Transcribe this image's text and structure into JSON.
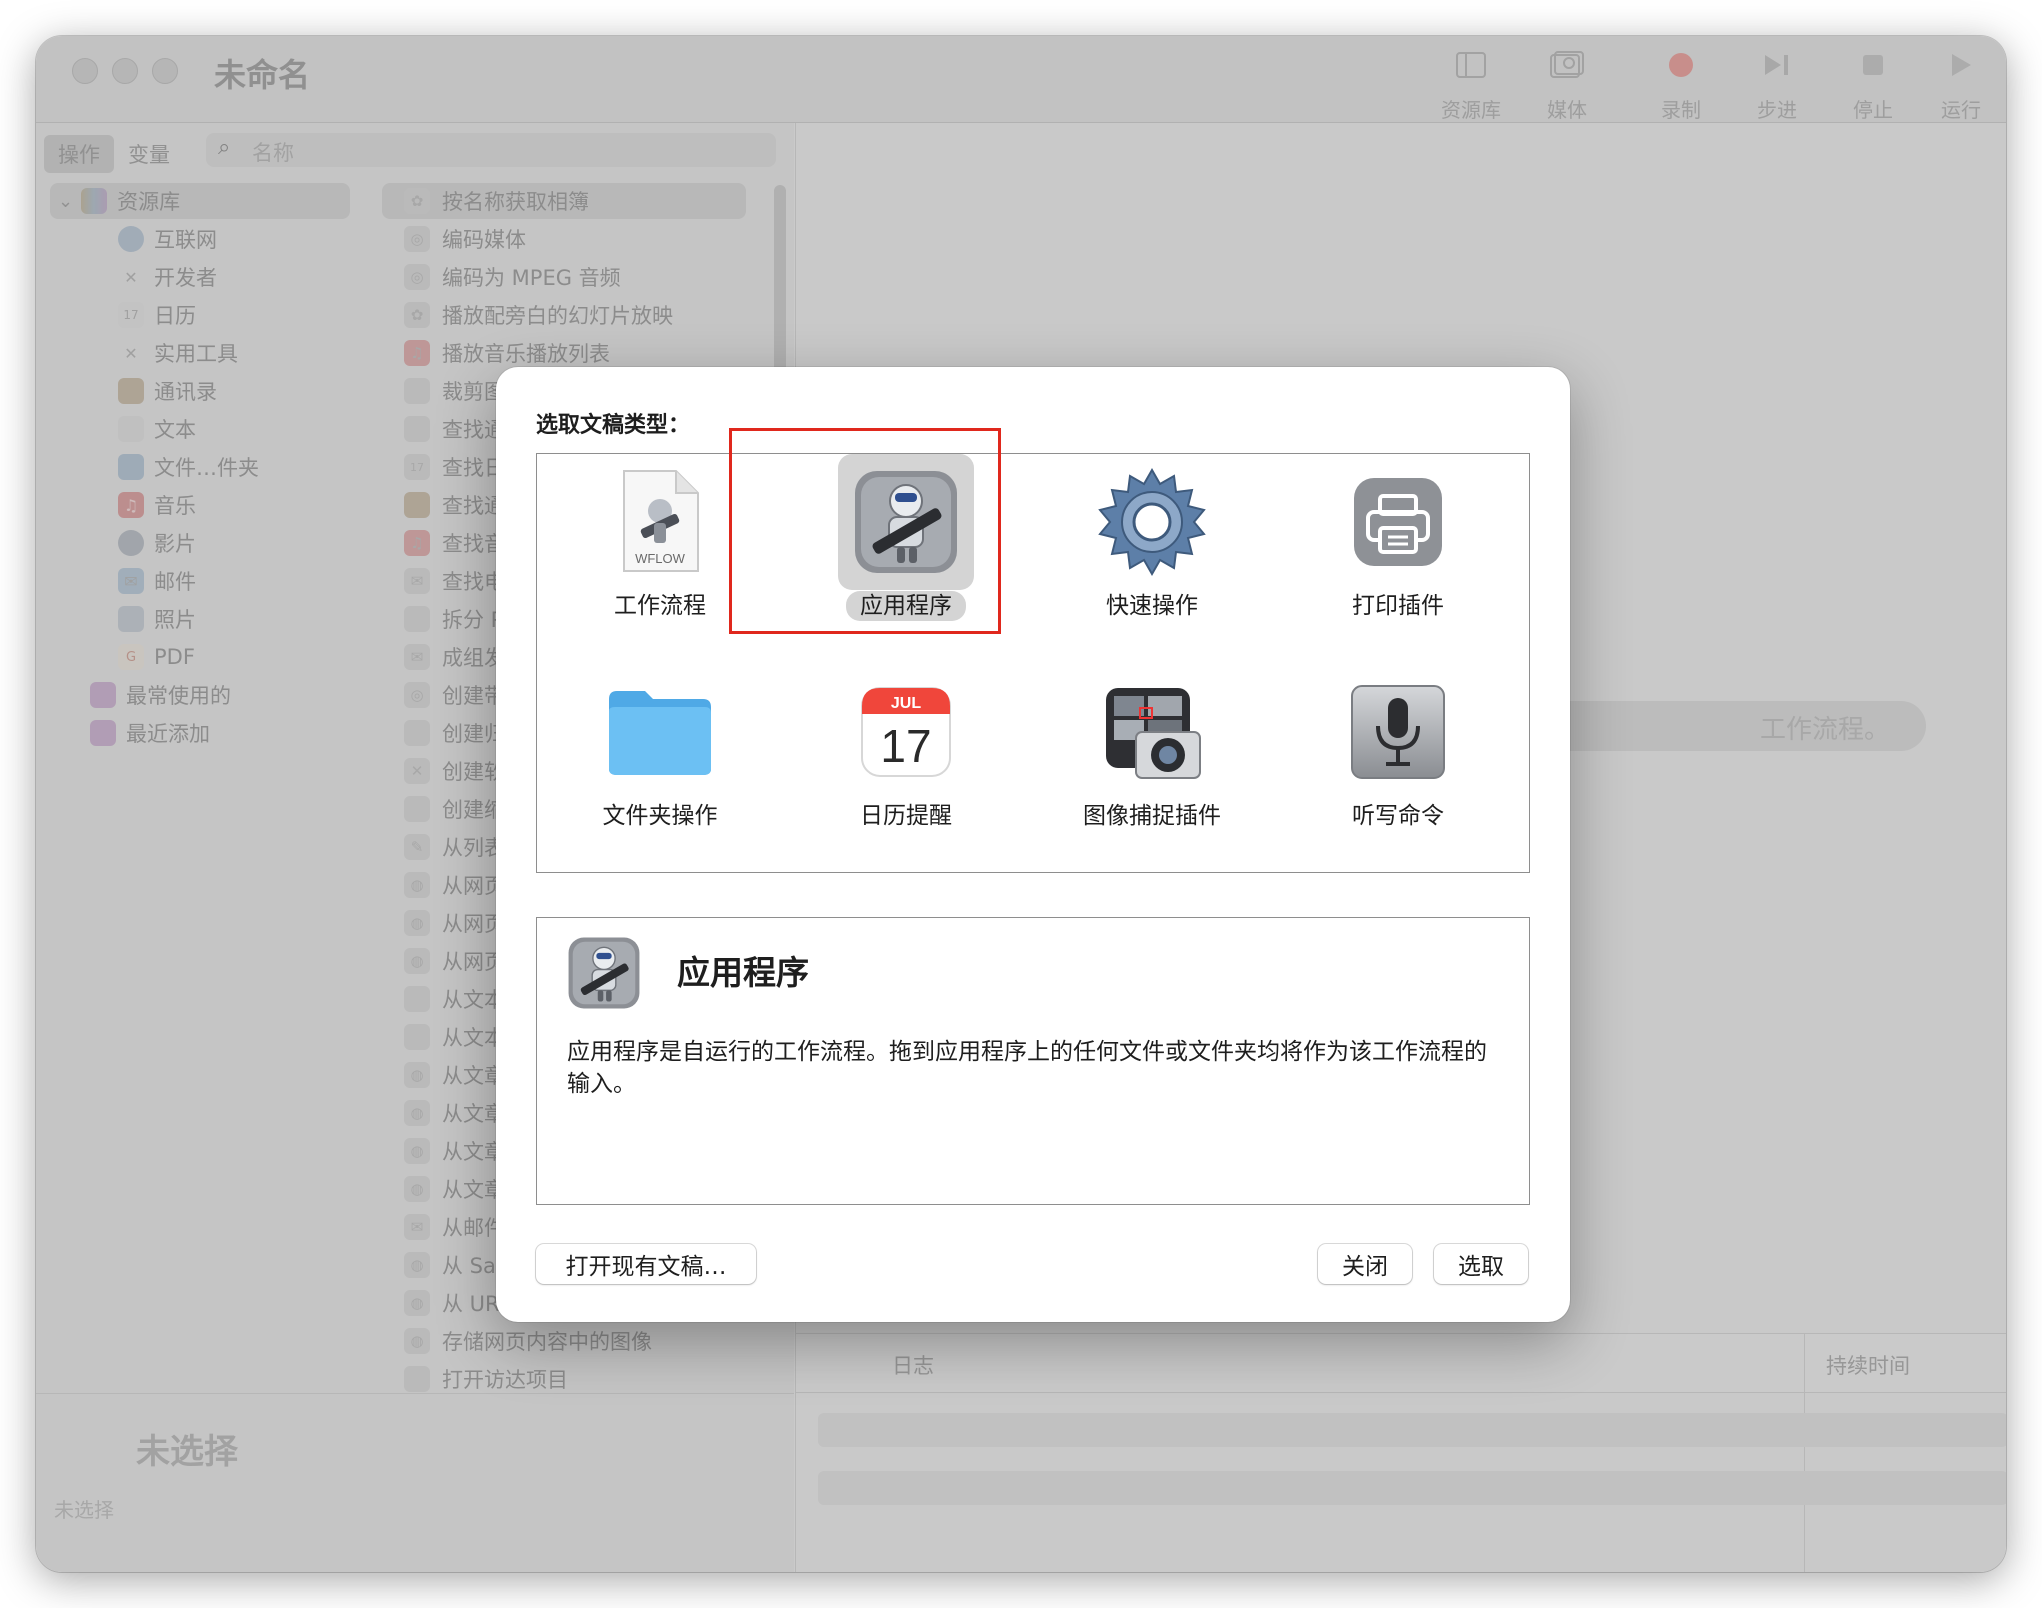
{
  "window": {
    "title": "未命名",
    "toolbar": [
      {
        "label": "资源库",
        "icon": "sidebar-icon"
      },
      {
        "label": "媒体",
        "icon": "photo-icon"
      },
      {
        "label": "录制",
        "icon": "record-icon"
      },
      {
        "label": "步进",
        "icon": "step-icon"
      },
      {
        "label": "停止",
        "icon": "stop-icon"
      },
      {
        "label": "运行",
        "icon": "play-icon"
      }
    ]
  },
  "library": {
    "tabs": [
      "操作",
      "变量"
    ],
    "search_placeholder": "名称",
    "categories": [
      {
        "label": "资源库",
        "icon": "library-icon"
      },
      {
        "label": "互联网",
        "icon": "globe-icon"
      },
      {
        "label": "开发者",
        "icon": "tools-icon"
      },
      {
        "label": "日历",
        "icon": "calendar-icon"
      },
      {
        "label": "实用工具",
        "icon": "tools-icon"
      },
      {
        "label": "通讯录",
        "icon": "contacts-icon"
      },
      {
        "label": "文本",
        "icon": "text-icon"
      },
      {
        "label": "文件…件夹",
        "icon": "finder-icon"
      },
      {
        "label": "音乐",
        "icon": "music-icon"
      },
      {
        "label": "影片",
        "icon": "movie-icon"
      },
      {
        "label": "邮件",
        "icon": "mail-icon"
      },
      {
        "label": "照片",
        "icon": "photo-icon"
      },
      {
        "label": "PDF",
        "icon": "pdf-icon"
      },
      {
        "label": "最常使用的",
        "icon": "folder-icon"
      },
      {
        "label": "最近添加",
        "icon": "folder-icon"
      }
    ],
    "actions": [
      "按名称获取相簿",
      "编码媒体",
      "编码为 MPEG 音频",
      "播放配旁白的幻灯片放映",
      "播放音乐播放列表",
      "裁剪图",
      "查找通",
      "查找日",
      "查找通",
      "查找音",
      "查找电",
      "拆分 P",
      "成组发",
      "创建带",
      "创建归",
      "创建软",
      "创建缩",
      "从列表",
      "从网页",
      "从网页",
      "从网页",
      "从文本",
      "从文本",
      "从文章",
      "从文章",
      "从文章",
      "从文章",
      "从邮件",
      "从 Safa",
      "从 URL 获取短文",
      "存储网页内容中的图像",
      "打开访达项目"
    ]
  },
  "description_pane": {
    "title": "未选择",
    "subtitle": "未选择"
  },
  "workflow_area": {
    "hint": "工作流程。",
    "log_col_log": "日志",
    "log_col_duration": "持续时间"
  },
  "dialog": {
    "prompt": "选取文稿类型：",
    "types": [
      {
        "label": "工作流程",
        "icon": "workflow-file-icon",
        "badge": "WFLOW"
      },
      {
        "label": "应用程序",
        "icon": "automator-robot-icon"
      },
      {
        "label": "快速操作",
        "icon": "gear-icon"
      },
      {
        "label": "打印插件",
        "icon": "printer-icon"
      },
      {
        "label": "文件夹操作",
        "icon": "folder-icon"
      },
      {
        "label": "日历提醒",
        "icon": "calendar-icon",
        "month": "JUL",
        "day": "17"
      },
      {
        "label": "图像捕捉插件",
        "icon": "image-capture-icon"
      },
      {
        "label": "听写命令",
        "icon": "microphone-icon"
      }
    ],
    "selected": "应用程序",
    "info_title": "应用程序",
    "info_text": "应用程序是自运行的工作流程。拖到应用程序上的任何文件或文件夹均将作为该工作流程的输入。",
    "btn_open": "打开现有文稿…",
    "btn_close": "关闭",
    "btn_choose": "选取",
    "colors": {
      "highlight_frame": "#e0281d",
      "folder": "#5ab6ef",
      "calendar_red": "#f0463b"
    }
  }
}
